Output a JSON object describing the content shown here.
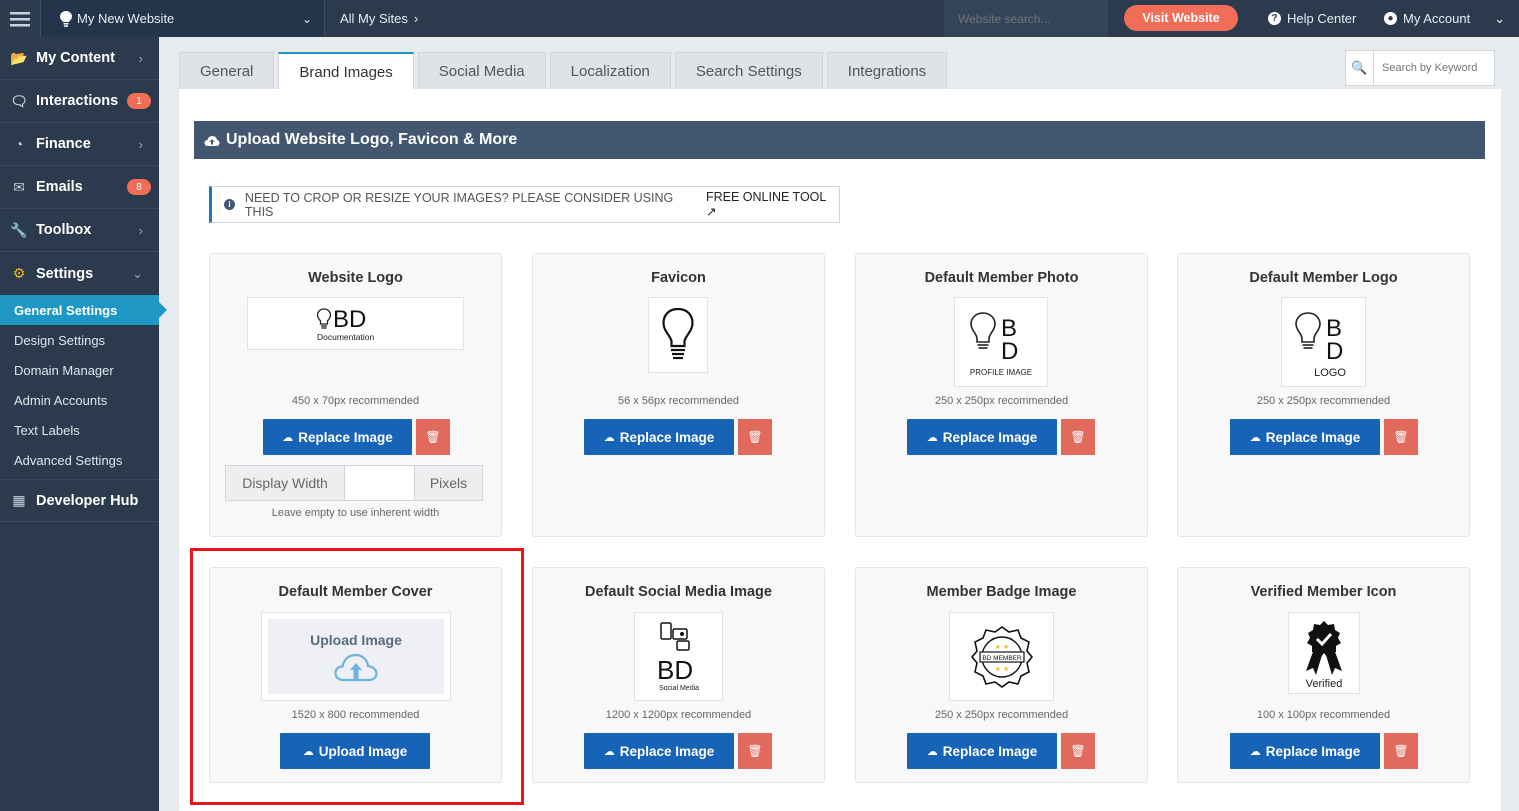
{
  "topbar": {
    "site_name": "My New Website",
    "all_sites": "All My Sites",
    "search_placeholder": "Website search...",
    "visit_label": "Visit Website",
    "help_label": "Help Center",
    "account_label": "My Account"
  },
  "sidebar": {
    "items": [
      {
        "label": "My Content",
        "icon": "folder-open-icon"
      },
      {
        "label": "Interactions",
        "icon": "comments-icon",
        "badge": "1"
      },
      {
        "label": "Finance",
        "icon": "pie-chart-icon"
      },
      {
        "label": "Emails",
        "icon": "inbox-icon",
        "badge": "8"
      },
      {
        "label": "Toolbox",
        "icon": "wrench-icon"
      },
      {
        "label": "Settings",
        "icon": "gear-icon"
      }
    ],
    "settings_sub": [
      "General Settings",
      "Design Settings",
      "Domain Manager",
      "Admin Accounts",
      "Text Labels",
      "Advanced Settings"
    ],
    "dev_hub": "Developer Hub"
  },
  "tabs": [
    "General",
    "Brand Images",
    "Social Media",
    "Localization",
    "Search Settings",
    "Integrations"
  ],
  "active_tab": "Brand Images",
  "keyword_placeholder": "Search by Keyword",
  "section_title": "Upload Website Logo, Favicon & More",
  "notice": {
    "text": "NEED TO CROP OR RESIZE YOUR IMAGES? PLEASE CONSIDER USING THIS",
    "link": "FREE ONLINE TOOL"
  },
  "cards": [
    {
      "title": "Website Logo",
      "rec": "450 x 70px recommended",
      "button": "Replace Image",
      "thumb_top": "BD",
      "thumb_bottom": "Documentation"
    },
    {
      "title": "Favicon",
      "rec": "56 x 56px recommended",
      "button": "Replace Image"
    },
    {
      "title": "Default Member Photo",
      "rec": "250 x 250px recommended",
      "button": "Replace Image",
      "thumb_caption": "PROFILE IMAGE"
    },
    {
      "title": "Default Member Logo",
      "rec": "250 x 250px recommended",
      "button": "Replace Image",
      "thumb_caption": "LOGO"
    },
    {
      "title": "Default Member Cover",
      "rec": "1520 x 800 recommended",
      "button": "Upload Image",
      "thumb_caption": "Upload Image"
    },
    {
      "title": "Default Social Media Image",
      "rec": "1200 x 1200px recommended",
      "button": "Replace Image",
      "thumb_top": "BD",
      "thumb_bottom": "Social Media"
    },
    {
      "title": "Member Badge Image",
      "rec": "250 x 250px recommended",
      "button": "Replace Image",
      "thumb_caption": "BD MEMBER"
    },
    {
      "title": "Verified Member Icon",
      "rec": "100 x 100px recommended",
      "button": "Replace Image",
      "thumb_caption": "Verified"
    }
  ],
  "display_width": {
    "label": "Display Width",
    "unit": "Pixels",
    "value": "",
    "hint": "Leave empty to use inherent width"
  },
  "colors": {
    "primary": "#1763b8",
    "danger": "#e26a5d",
    "accent": "#f26d57",
    "sidebar": "#2b3a4d",
    "highlight": "#e8141c"
  }
}
